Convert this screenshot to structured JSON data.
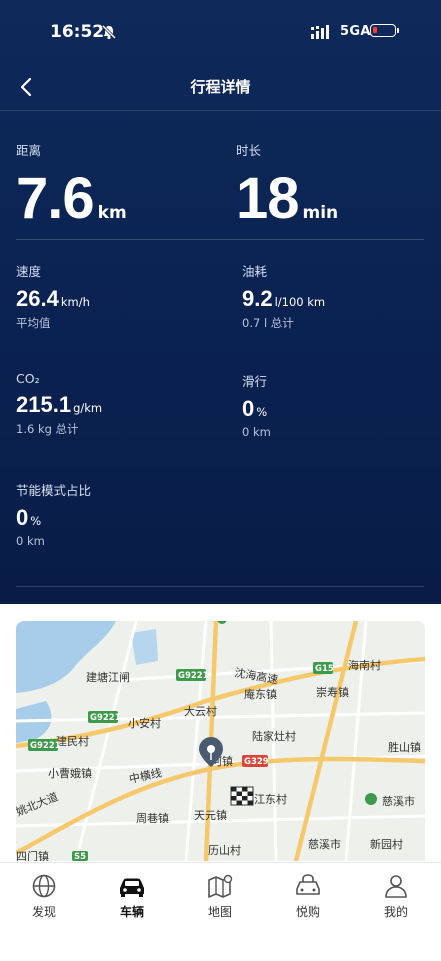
{
  "status": {
    "time": "16:52",
    "network": "5GA"
  },
  "header": {
    "title": "行程详情"
  },
  "metrics": {
    "distance": {
      "label": "距离",
      "value": "7.6",
      "unit": "km"
    },
    "duration": {
      "label": "时长",
      "value": "18",
      "unit": "min"
    },
    "speed": {
      "label": "速度",
      "value": "26.4",
      "unit": "km/h",
      "sub": "平均值"
    },
    "fuel": {
      "label": "油耗",
      "value": "9.2",
      "unit": "l/100 km",
      "sub": "0.7 l 总计"
    },
    "co2": {
      "label": "CO₂",
      "value": "215.1",
      "unit": "g/km",
      "sub": "1.6 kg 总计"
    },
    "coasting": {
      "label": "滑行",
      "value": "0",
      "unit": "%",
      "sub": "0 km"
    },
    "eco": {
      "label": "节能模式占比",
      "value": "0",
      "unit": "%",
      "sub": "0 km"
    }
  },
  "map": {
    "places": [
      "建塘江闸",
      "沈海高速",
      "海南村",
      "庵东镇",
      "崇寿镇",
      "大云村",
      "小安村",
      "建民村",
      "陆家灶村",
      "胜山镇",
      "小曹娥镇",
      "中横线",
      "河镇",
      "周巷镇",
      "天元镇",
      "江东村",
      "慈溪市",
      "姚北大道",
      "新园村",
      "慈溪市",
      "历山村",
      "四门镇"
    ],
    "shields": [
      "G9221",
      "G15",
      "G9221",
      "G9221",
      "G329",
      "S5"
    ]
  },
  "tabs": [
    {
      "label": "发现",
      "icon": "globe-icon"
    },
    {
      "label": "车辆",
      "icon": "car-icon",
      "active": true
    },
    {
      "label": "地图",
      "icon": "map-icon"
    },
    {
      "label": "悦购",
      "icon": "shop-icon"
    },
    {
      "label": "我的",
      "icon": "person-icon"
    }
  ],
  "colors": {
    "header_bg": "#0b2353",
    "map_water": "#a8cdea",
    "highway": "#f5c96b",
    "road": "#ffffff",
    "shield_green": "#3d9a4a",
    "shield_red": "#d9443b"
  }
}
